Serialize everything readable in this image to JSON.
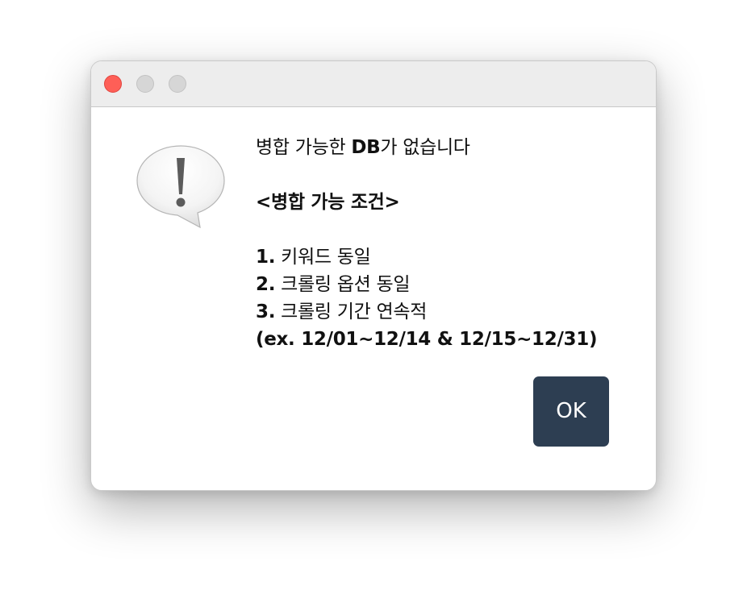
{
  "window": {
    "controls": {
      "close": "close",
      "minimize": "minimize",
      "zoom": "zoom"
    },
    "colors": {
      "close": "#fe5f57",
      "inactive": "#d6d6d6",
      "titlebar": "#ededed"
    }
  },
  "alert": {
    "icon": "exclamation-speech-bubble-icon",
    "message": {
      "title_prefix": "병합 가능한 ",
      "title_bold": "DB",
      "title_suffix": "가 없습니다",
      "conditions_heading": "<병합 가능 조건>",
      "conditions": [
        {
          "num": "1.",
          "text": " 키워드 동일"
        },
        {
          "num": "2.",
          "text": " 크롤링 옵션 동일"
        },
        {
          "num": "3.",
          "text": " 크롤링 기간 연속적"
        }
      ],
      "example": "(ex. 12/01~12/14 & 12/15~12/31)"
    },
    "ok_label": "OK",
    "ok_color": "#2d3e52"
  }
}
